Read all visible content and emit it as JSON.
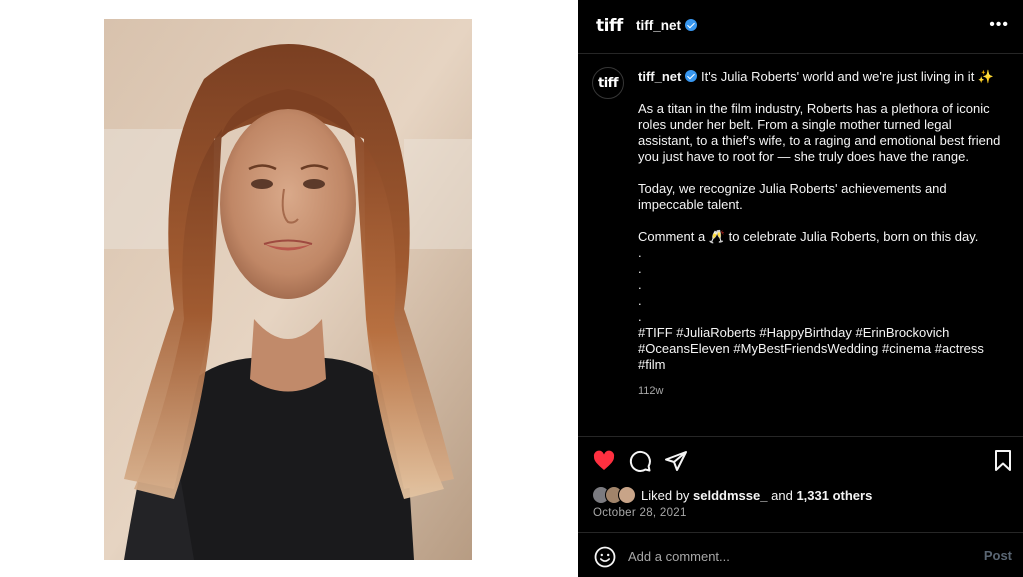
{
  "post": {
    "brand_logo": "tiff",
    "username": "tiff_net",
    "more_icon": "•••",
    "caption": {
      "username": "tiff_net",
      "headline": "It's Julia Roberts' world and we're just living in it ✨",
      "paragraph1": "As a titan in the film industry, Roberts has a plethora of iconic roles under her belt. From a single mother turned legal assistant, to a thief's wife, to a raging and emotional best friend you just have to root for — she truly does have the range.",
      "paragraph2": "Today, we recognize Julia Roberts' achievements and impeccable talent.",
      "paragraph3": "Comment a 🥂 to celebrate Julia Roberts, born on this day.",
      "dots": [
        ".",
        ".",
        ".",
        ".",
        "."
      ],
      "hashtags": "#TIFF #JuliaRoberts #HappyBirthday #ErinBrockovich #OceansEleven #MyBestFriendsWedding #cinema #actress #film",
      "time_ago": "112w"
    },
    "likes": {
      "prefix": "Liked by ",
      "user": "selddmsse_",
      "and": " and ",
      "others": "1,331 others"
    },
    "date": "October 28, 2021",
    "comment": {
      "placeholder": "Add a comment...",
      "post_label": "Post"
    }
  },
  "icons": [
    "heart-icon",
    "comment-icon",
    "share-icon",
    "bookmark-icon",
    "emoji-icon",
    "verified-badge-icon",
    "more-icon"
  ],
  "colors": {
    "background": "#000000",
    "text": "#f5f5f5",
    "secondary_text": "#a8a8a8",
    "verified": "#3897f0",
    "like": "#ff3040",
    "post_button": "#5a6673"
  }
}
